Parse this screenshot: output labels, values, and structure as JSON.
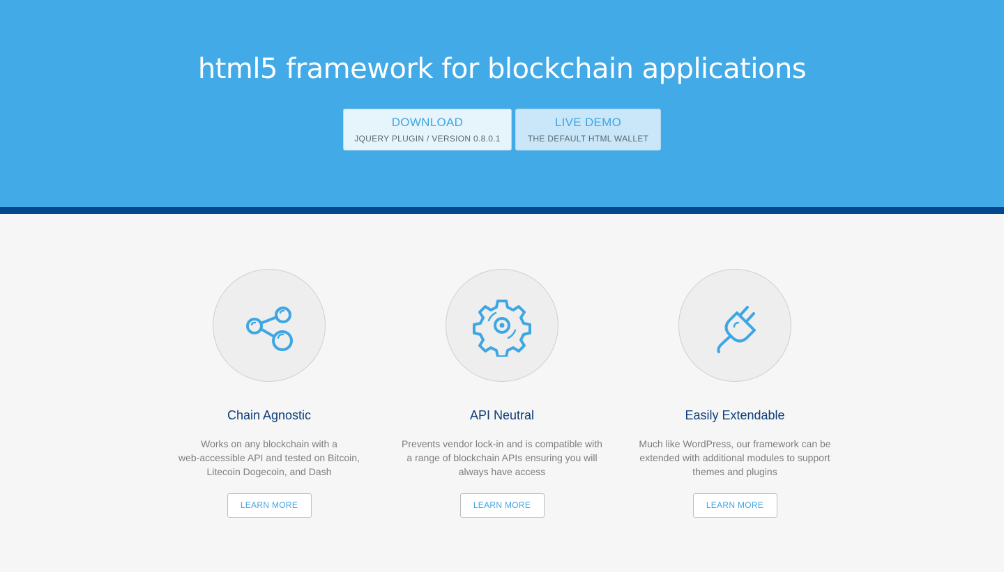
{
  "hero": {
    "title": "html5 framework for blockchain applications",
    "download": {
      "label": "DOWNLOAD",
      "sub": "JQUERY PLUGIN / VERSION 0.8.0.1"
    },
    "demo": {
      "label": "LIVE DEMO",
      "sub": "THE DEFAULT HTML WALLET"
    }
  },
  "features": [
    {
      "icon": "share-nodes-icon",
      "title": "Chain Agnostic",
      "desc_lines": [
        "Works on any blockchain with a",
        "web-accessible API and tested on Bitcoin,",
        "Litecoin Dogecoin, and Dash"
      ],
      "button": "LEARN MORE"
    },
    {
      "icon": "gear-icon",
      "title": "API Neutral",
      "desc_lines": [
        "Prevents vendor lock-in and is compatible with",
        "a range of blockchain APIs ensuring you will",
        "always have access"
      ],
      "button": "LEARN MORE"
    },
    {
      "icon": "plug-icon",
      "title": "Easily Extendable",
      "desc_lines": [
        "Much like WordPress, our framework can be",
        "extended with additional modules to support",
        "themes and plugins"
      ],
      "button": "LEARN MORE"
    }
  ],
  "colors": {
    "hero_bg": "#42aae6",
    "stripe": "#03488e",
    "accent": "#3ea6e3",
    "feature_title": "#0c3d78"
  }
}
